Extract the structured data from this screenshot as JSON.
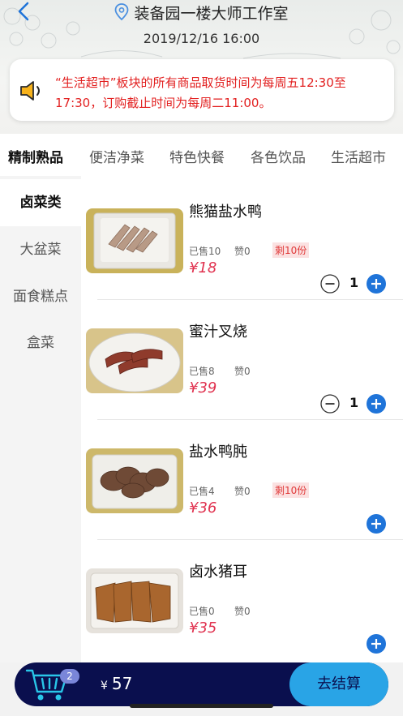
{
  "header": {
    "location": "装备园一楼大师工作室",
    "datetime": "2019/12/16 16:00"
  },
  "notice": {
    "text": "“生活超市”板块的所有商品取货时间为每周五12:30至17:30，订购截止时间为每周二11:00。",
    "color": "#e21f1f"
  },
  "tabs": [
    "精制熟品",
    "便洁净菜",
    "特色快餐",
    "各色饮品",
    "生活超市"
  ],
  "sidebar": [
    "卤菜类",
    "大盆菜",
    "面食糕点",
    "盒菜"
  ],
  "products": [
    {
      "name": "熊猫盐水鸭",
      "sold": "已售10",
      "likes": "赞0",
      "stock": "剩10份",
      "price": "¥18",
      "qty": "1",
      "image": "salted-duck-slices"
    },
    {
      "name": "蜜汁叉烧",
      "sold": "已售8",
      "likes": "赞0",
      "stock": "",
      "price": "¥39",
      "qty": "1",
      "image": "char-siu-pork"
    },
    {
      "name": "盐水鸭肫",
      "sold": "已售4",
      "likes": "赞0",
      "stock": "剩10份",
      "price": "¥36",
      "qty": "",
      "image": "duck-gizzard"
    },
    {
      "name": "卤水猪耳",
      "sold": "已售0",
      "likes": "赞0",
      "stock": "",
      "price": "¥35",
      "qty": "",
      "image": "pig-ear"
    }
  ],
  "cart": {
    "count": "2",
    "currency": "¥",
    "total": "57",
    "checkout_label": "去结算"
  },
  "colors": {
    "accent": "#1f74d9",
    "price": "#e0324f",
    "cartbar": "#0a0f4e",
    "checkout": "#29a4e6"
  },
  "icons": [
    "back-icon",
    "location-pin-icon",
    "speaker-icon",
    "minus-icon",
    "plus-icon",
    "cart-icon"
  ]
}
